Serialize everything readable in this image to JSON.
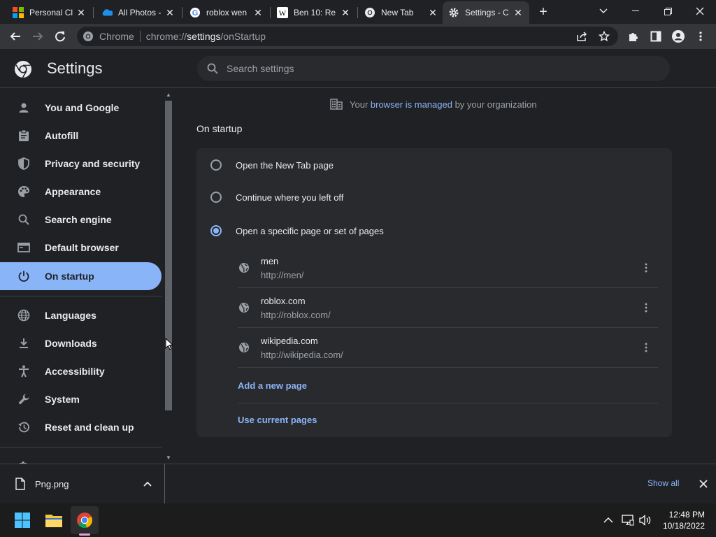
{
  "browser": {
    "tabs": [
      {
        "title": "Personal Cl",
        "favicon": "windows-logo-icon"
      },
      {
        "title": "All Photos -",
        "favicon": "onedrive-icon"
      },
      {
        "title": "roblox wen",
        "favicon": "google-icon"
      },
      {
        "title": "Ben 10: Re",
        "favicon": "wikipedia-icon"
      },
      {
        "title": "New Tab",
        "favicon": "chrome-icon"
      },
      {
        "title": "Settings - C",
        "favicon": "gear-icon",
        "active": true
      }
    ],
    "omnibox": {
      "site": "Chrome",
      "url_prefix": "chrome://",
      "url_host": "settings",
      "url_path": "/onStartup"
    }
  },
  "settings": {
    "title": "Settings",
    "search_placeholder": "Search settings",
    "nav": [
      {
        "label": "You and Google",
        "icon": "person-icon"
      },
      {
        "label": "Autofill",
        "icon": "clipboard-icon"
      },
      {
        "label": "Privacy and security",
        "icon": "shield-icon"
      },
      {
        "label": "Appearance",
        "icon": "palette-icon"
      },
      {
        "label": "Search engine",
        "icon": "search-icon"
      },
      {
        "label": "Default browser",
        "icon": "browser-window-icon"
      },
      {
        "label": "On startup",
        "icon": "power-icon",
        "selected": true
      },
      {
        "label": "Languages",
        "icon": "globe-icon"
      },
      {
        "label": "Downloads",
        "icon": "download-icon"
      },
      {
        "label": "Accessibility",
        "icon": "accessibility-icon"
      },
      {
        "label": "System",
        "icon": "wrench-icon"
      },
      {
        "label": "Reset and clean up",
        "icon": "history-icon"
      }
    ],
    "managed": {
      "prefix": "Your ",
      "link": "browser is managed",
      "suffix": " by your organization"
    },
    "section_title": "On startup",
    "options": [
      {
        "label": "Open the New Tab page",
        "checked": false
      },
      {
        "label": "Continue where you left off",
        "checked": false
      },
      {
        "label": "Open a specific page or set of pages",
        "checked": true
      }
    ],
    "pages": [
      {
        "name": "men",
        "url": "http://men/"
      },
      {
        "name": "roblox.com",
        "url": "http://roblox.com/"
      },
      {
        "name": "wikipedia.com",
        "url": "http://wikipedia.com/"
      }
    ],
    "add_page_label": "Add a new page",
    "use_current_label": "Use current pages"
  },
  "download_shelf": {
    "file_name": "Png.png",
    "show_all_label": "Show all"
  },
  "taskbar": {
    "time": "12:48 PM",
    "date": "10/18/2022"
  },
  "colors": {
    "accent": "#8ab4f8",
    "background": "#202124",
    "card": "#292a2d"
  }
}
